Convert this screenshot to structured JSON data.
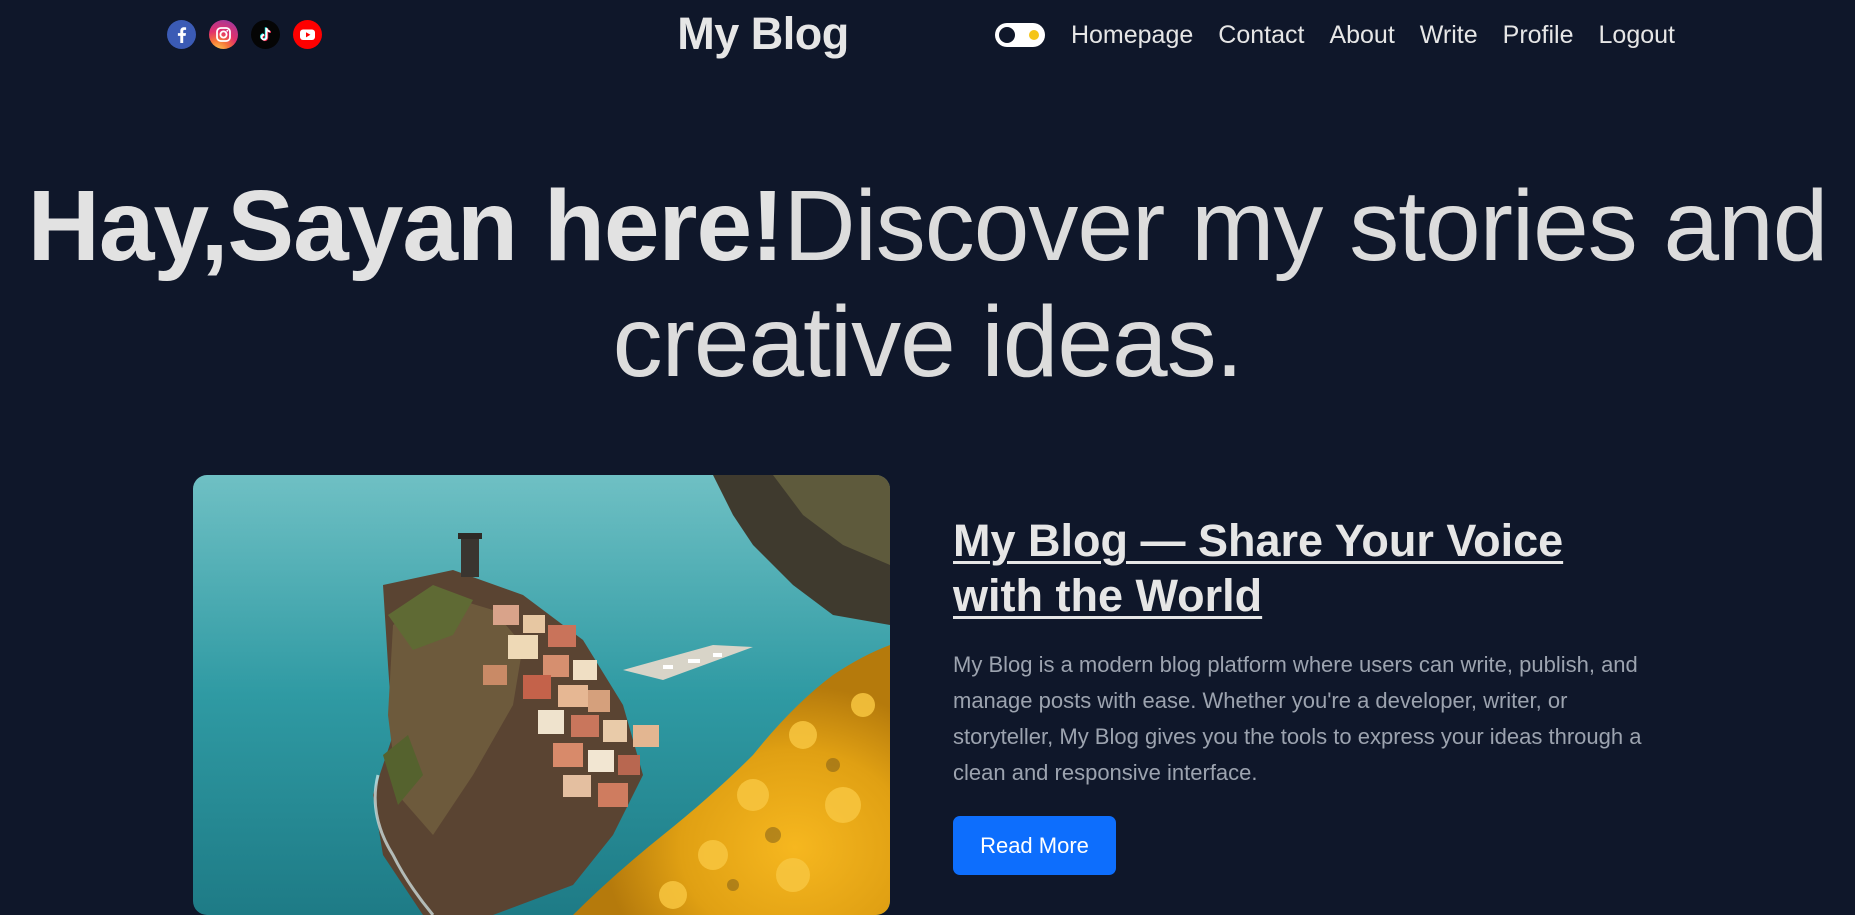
{
  "header": {
    "site_title": "My Blog",
    "socials": [
      {
        "icon": "facebook-icon",
        "color": "#3b5bb5"
      },
      {
        "icon": "instagram-icon",
        "color": "#e1306c"
      },
      {
        "icon": "tiktok-icon",
        "color": "#050505"
      },
      {
        "icon": "youtube-icon",
        "color": "#ff0000"
      }
    ],
    "theme_toggle": {
      "state": "dark"
    },
    "nav": [
      "Homepage",
      "Contact",
      "About",
      "Write",
      "Profile",
      "Logout"
    ]
  },
  "hero": {
    "bold_text": "Hay,Sayan here!",
    "light_text": "Discover my stories and creative ideas."
  },
  "featured_post": {
    "title": "My Blog — Share Your Voice with the World",
    "excerpt": "My Blog is a modern blog platform where users can write, publish, and manage posts with ease. Whether you're a developer, writer, or storyteller, My Blog gives you the tools to express your ideas through a clean and responsive interface.",
    "button_label": "Read More"
  },
  "colors": {
    "background": "#0f172a",
    "accent": "#0d6efd",
    "text": "#e2e2e2",
    "muted": "#9ca3af"
  }
}
